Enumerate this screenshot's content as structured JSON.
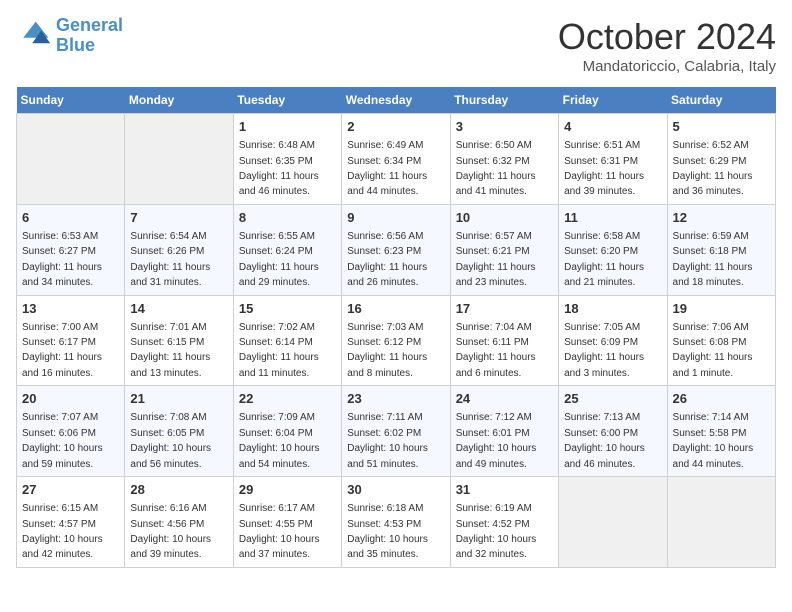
{
  "header": {
    "logo_line1": "General",
    "logo_line2": "Blue",
    "month": "October 2024",
    "location": "Mandatoriccio, Calabria, Italy"
  },
  "days_of_week": [
    "Sunday",
    "Monday",
    "Tuesday",
    "Wednesday",
    "Thursday",
    "Friday",
    "Saturday"
  ],
  "weeks": [
    [
      null,
      null,
      {
        "day": 1,
        "sunrise": "6:48 AM",
        "sunset": "6:35 PM",
        "daylight": "11 hours and 46 minutes."
      },
      {
        "day": 2,
        "sunrise": "6:49 AM",
        "sunset": "6:34 PM",
        "daylight": "11 hours and 44 minutes."
      },
      {
        "day": 3,
        "sunrise": "6:50 AM",
        "sunset": "6:32 PM",
        "daylight": "11 hours and 41 minutes."
      },
      {
        "day": 4,
        "sunrise": "6:51 AM",
        "sunset": "6:31 PM",
        "daylight": "11 hours and 39 minutes."
      },
      {
        "day": 5,
        "sunrise": "6:52 AM",
        "sunset": "6:29 PM",
        "daylight": "11 hours and 36 minutes."
      }
    ],
    [
      {
        "day": 6,
        "sunrise": "6:53 AM",
        "sunset": "6:27 PM",
        "daylight": "11 hours and 34 minutes."
      },
      {
        "day": 7,
        "sunrise": "6:54 AM",
        "sunset": "6:26 PM",
        "daylight": "11 hours and 31 minutes."
      },
      {
        "day": 8,
        "sunrise": "6:55 AM",
        "sunset": "6:24 PM",
        "daylight": "11 hours and 29 minutes."
      },
      {
        "day": 9,
        "sunrise": "6:56 AM",
        "sunset": "6:23 PM",
        "daylight": "11 hours and 26 minutes."
      },
      {
        "day": 10,
        "sunrise": "6:57 AM",
        "sunset": "6:21 PM",
        "daylight": "11 hours and 23 minutes."
      },
      {
        "day": 11,
        "sunrise": "6:58 AM",
        "sunset": "6:20 PM",
        "daylight": "11 hours and 21 minutes."
      },
      {
        "day": 12,
        "sunrise": "6:59 AM",
        "sunset": "6:18 PM",
        "daylight": "11 hours and 18 minutes."
      }
    ],
    [
      {
        "day": 13,
        "sunrise": "7:00 AM",
        "sunset": "6:17 PM",
        "daylight": "11 hours and 16 minutes."
      },
      {
        "day": 14,
        "sunrise": "7:01 AM",
        "sunset": "6:15 PM",
        "daylight": "11 hours and 13 minutes."
      },
      {
        "day": 15,
        "sunrise": "7:02 AM",
        "sunset": "6:14 PM",
        "daylight": "11 hours and 11 minutes."
      },
      {
        "day": 16,
        "sunrise": "7:03 AM",
        "sunset": "6:12 PM",
        "daylight": "11 hours and 8 minutes."
      },
      {
        "day": 17,
        "sunrise": "7:04 AM",
        "sunset": "6:11 PM",
        "daylight": "11 hours and 6 minutes."
      },
      {
        "day": 18,
        "sunrise": "7:05 AM",
        "sunset": "6:09 PM",
        "daylight": "11 hours and 3 minutes."
      },
      {
        "day": 19,
        "sunrise": "7:06 AM",
        "sunset": "6:08 PM",
        "daylight": "11 hours and 1 minute."
      }
    ],
    [
      {
        "day": 20,
        "sunrise": "7:07 AM",
        "sunset": "6:06 PM",
        "daylight": "10 hours and 59 minutes."
      },
      {
        "day": 21,
        "sunrise": "7:08 AM",
        "sunset": "6:05 PM",
        "daylight": "10 hours and 56 minutes."
      },
      {
        "day": 22,
        "sunrise": "7:09 AM",
        "sunset": "6:04 PM",
        "daylight": "10 hours and 54 minutes."
      },
      {
        "day": 23,
        "sunrise": "7:11 AM",
        "sunset": "6:02 PM",
        "daylight": "10 hours and 51 minutes."
      },
      {
        "day": 24,
        "sunrise": "7:12 AM",
        "sunset": "6:01 PM",
        "daylight": "10 hours and 49 minutes."
      },
      {
        "day": 25,
        "sunrise": "7:13 AM",
        "sunset": "6:00 PM",
        "daylight": "10 hours and 46 minutes."
      },
      {
        "day": 26,
        "sunrise": "7:14 AM",
        "sunset": "5:58 PM",
        "daylight": "10 hours and 44 minutes."
      }
    ],
    [
      {
        "day": 27,
        "sunrise": "6:15 AM",
        "sunset": "4:57 PM",
        "daylight": "10 hours and 42 minutes."
      },
      {
        "day": 28,
        "sunrise": "6:16 AM",
        "sunset": "4:56 PM",
        "daylight": "10 hours and 39 minutes."
      },
      {
        "day": 29,
        "sunrise": "6:17 AM",
        "sunset": "4:55 PM",
        "daylight": "10 hours and 37 minutes."
      },
      {
        "day": 30,
        "sunrise": "6:18 AM",
        "sunset": "4:53 PM",
        "daylight": "10 hours and 35 minutes."
      },
      {
        "day": 31,
        "sunrise": "6:19 AM",
        "sunset": "4:52 PM",
        "daylight": "10 hours and 32 minutes."
      },
      null,
      null
    ]
  ]
}
